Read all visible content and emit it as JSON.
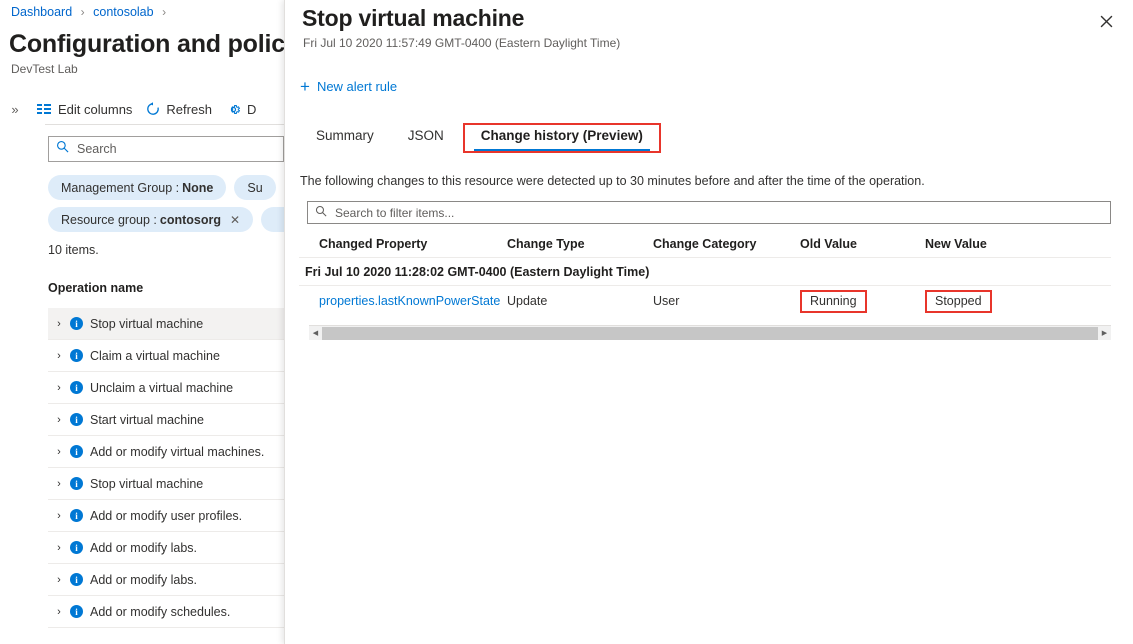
{
  "left_blade": {
    "breadcrumb": [
      {
        "label": "Dashboard"
      },
      {
        "label": "contosolab"
      }
    ],
    "breadcrumb_separator": "›",
    "title": "Configuration and policies",
    "subtitle": "DevTest Lab",
    "expand_chevron": "»",
    "toolbar": [
      {
        "icon": "edit-columns-icon",
        "label": "Edit columns"
      },
      {
        "icon": "refresh-icon",
        "label": "Refresh"
      },
      {
        "icon": "gear-icon",
        "label": "D"
      }
    ],
    "search": {
      "placeholder": "Search",
      "value": "",
      "icon": "search-icon"
    },
    "filters": [
      {
        "label": "Management Group :",
        "value": "None",
        "removable": false
      },
      {
        "label": "Su",
        "value": "",
        "removable": false
      },
      {
        "label": "Resource group :",
        "value": "contosorg",
        "removable": true,
        "remove_icon": "close-icon"
      }
    ],
    "items_count": "10 items.",
    "column_header": "Operation name",
    "operations": [
      {
        "label": "Stop virtual machine",
        "selected": true
      },
      {
        "label": "Claim a virtual machine",
        "selected": false
      },
      {
        "label": "Unclaim a virtual machine",
        "selected": false
      },
      {
        "label": "Start virtual machine",
        "selected": false
      },
      {
        "label": "Add or modify virtual machines.",
        "selected": false
      },
      {
        "label": "Stop virtual machine",
        "selected": false
      },
      {
        "label": "Add or modify user profiles.",
        "selected": false
      },
      {
        "label": "Add or modify labs.",
        "selected": false
      },
      {
        "label": "Add or modify labs.",
        "selected": false
      },
      {
        "label": "Add or modify schedules.",
        "selected": false
      }
    ],
    "row_chevron": "›",
    "row_info_icon": "info-icon",
    "row_info_glyph": "i"
  },
  "panel": {
    "title": "Stop virtual machine",
    "subtitle": "Fri Jul 10 2020 11:57:49 GMT-0400 (Eastern Daylight Time)",
    "close_icon": "close-icon",
    "close_glyph": "✕",
    "command": {
      "icon": "plus-icon",
      "plus_glyph": "+",
      "label": "New alert rule"
    },
    "tabs": [
      {
        "label": "Summary",
        "active": false,
        "highlighted": false
      },
      {
        "label": "JSON",
        "active": false,
        "highlighted": false
      },
      {
        "label": "Change history (Preview)",
        "active": true,
        "highlighted": true
      }
    ],
    "description": "The following changes to this resource were detected up to 30 minutes before and after the time of the operation.",
    "filter": {
      "placeholder": "Search to filter items...",
      "value": "",
      "icon": "search-icon"
    },
    "table": {
      "headers": [
        "Changed Property",
        "Change Type",
        "Change Category",
        "Old Value",
        "New Value"
      ],
      "group_label": "Fri Jul 10 2020 11:28:02 GMT-0400 (Eastern Daylight Time)",
      "rows": [
        {
          "changed_property": "properties.lastKnownPowerState",
          "change_type": "Update",
          "change_category": "User",
          "old_value": "Running",
          "new_value": "Stopped"
        }
      ]
    },
    "scrollbar": {
      "left_arrow": "◀",
      "right_arrow": "▶"
    }
  },
  "colors": {
    "accent_blue": "#0078d4",
    "link_blue": "#0066cc",
    "highlight_red": "#e8352b",
    "pill_bg": "#deecf9",
    "selected_row": "#f3f2f1"
  }
}
